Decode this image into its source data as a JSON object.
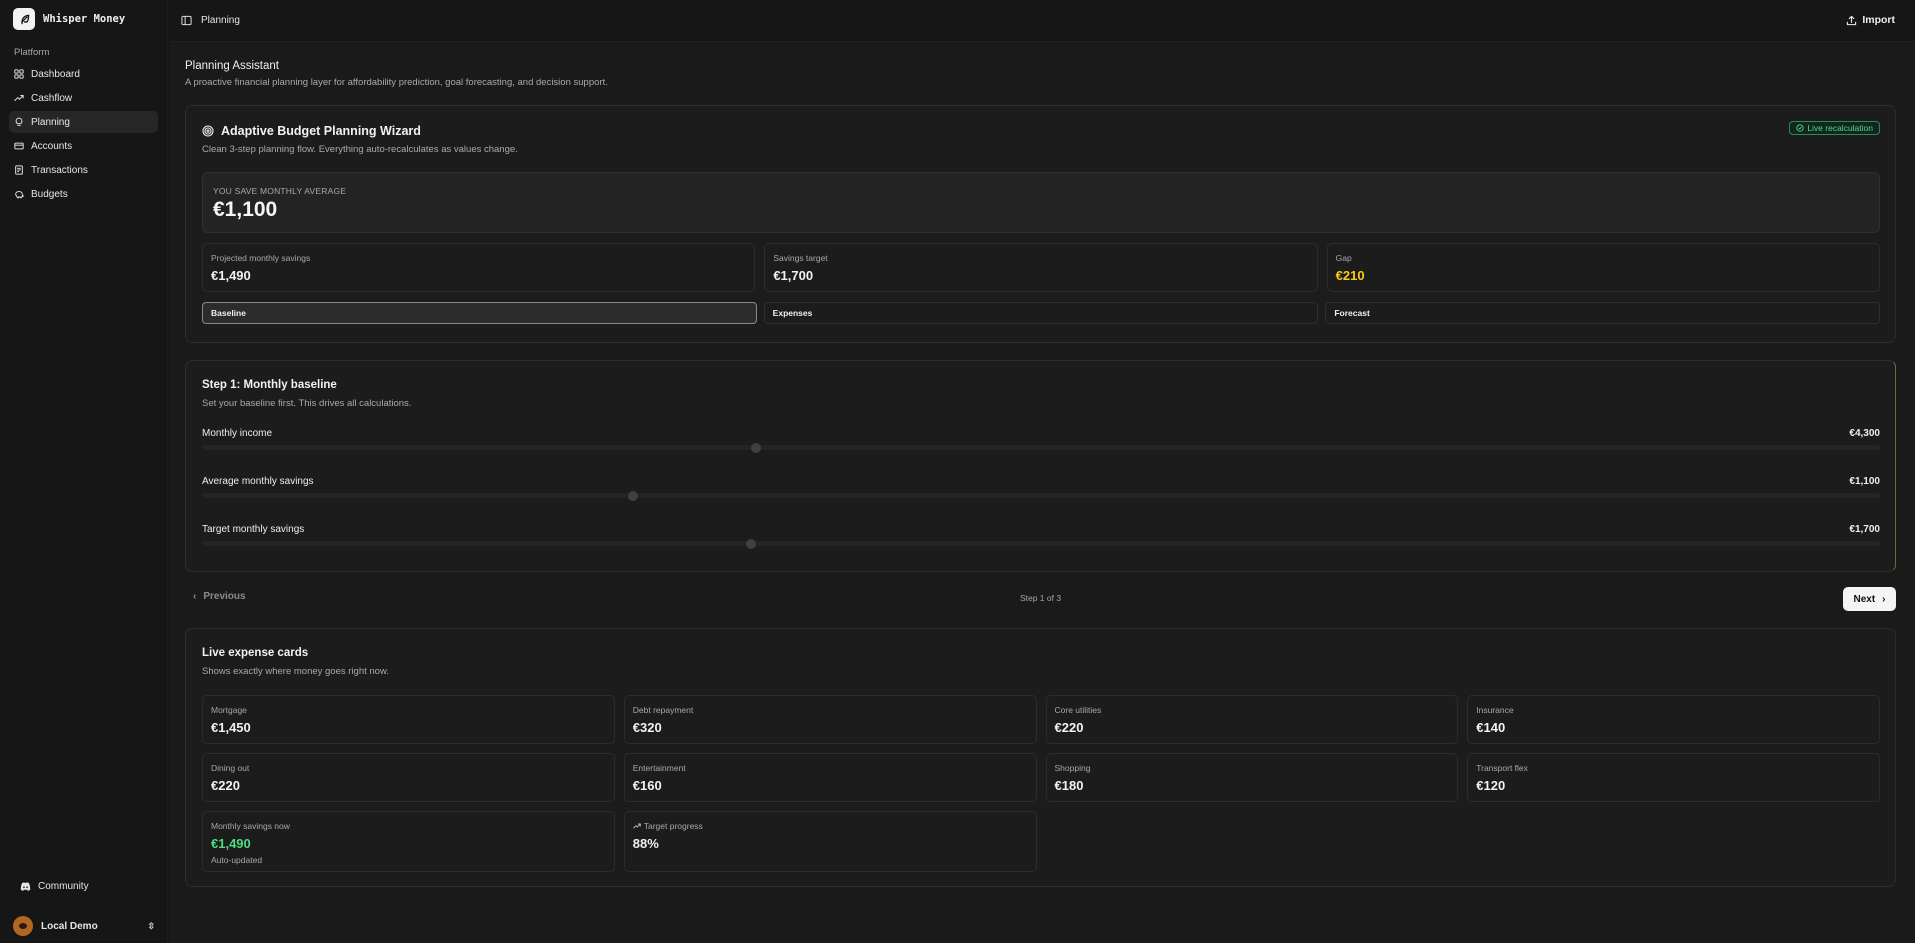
{
  "app": {
    "name": "Whisper Money"
  },
  "sidebar": {
    "group_label": "Platform",
    "items": [
      {
        "label": "Dashboard",
        "icon": "grid-icon",
        "active": false
      },
      {
        "label": "Cashflow",
        "icon": "trend-up-icon",
        "active": false
      },
      {
        "label": "Planning",
        "icon": "lightbulb-icon",
        "active": true
      },
      {
        "label": "Accounts",
        "icon": "card-icon",
        "active": false
      },
      {
        "label": "Transactions",
        "icon": "receipt-icon",
        "active": false
      },
      {
        "label": "Budgets",
        "icon": "piggy-bank-icon",
        "active": false
      }
    ],
    "community_label": "Community",
    "user_name": "Local Demo"
  },
  "topbar": {
    "title": "Planning",
    "import_label": "Import"
  },
  "page": {
    "title": "Planning Assistant",
    "subtitle": "A proactive financial planning layer for affordability prediction, goal forecasting, and decision support."
  },
  "wizard": {
    "title": "Adaptive Budget Planning Wizard",
    "subtitle": "Clean 3-step planning flow. Everything auto-recalculates as values change.",
    "badge": "Live recalculation",
    "hero_label": "YOU SAVE MONTHLY AVERAGE",
    "hero_value": "€1,100",
    "stats": [
      {
        "label": "Projected monthly savings",
        "value": "€1,490"
      },
      {
        "label": "Savings target",
        "value": "€1,700"
      },
      {
        "label": "Gap",
        "value": "€210",
        "color": "#facc15"
      }
    ],
    "tabs": [
      "Baseline",
      "Expenses",
      "Forecast"
    ],
    "active_tab": "Baseline"
  },
  "baseline": {
    "title": "Step 1: Monthly baseline",
    "subtitle": "Set your baseline first. This drives all calculations.",
    "sliders": [
      {
        "label": "Monthly income",
        "value": "€4,300",
        "level": 0.33
      },
      {
        "label": "Average monthly savings",
        "value": "€1,100",
        "level": 0.257
      },
      {
        "label": "Target monthly savings",
        "value": "€1,700",
        "level": 0.327
      }
    ]
  },
  "wizard_nav": {
    "previous_label": "Previous",
    "step_text": "Step 1 of 3",
    "next_label": "Next"
  },
  "expenses": {
    "title": "Live expense cards",
    "subtitle": "Shows exactly where money goes right now.",
    "cards": [
      {
        "label": "Mortgage",
        "value": "€1,450"
      },
      {
        "label": "Debt repayment",
        "value": "€320"
      },
      {
        "label": "Core utilities",
        "value": "€220"
      },
      {
        "label": "Insurance",
        "value": "€140"
      },
      {
        "label": "Dining out",
        "value": "€220"
      },
      {
        "label": "Entertainment",
        "value": "€160"
      },
      {
        "label": "Shopping",
        "value": "€180"
      },
      {
        "label": "Transport flex",
        "value": "€120"
      }
    ],
    "savings_now": {
      "label": "Monthly savings now",
      "value": "€1,490",
      "note": "Auto-updated",
      "color": "#4ade80"
    },
    "target_progress": {
      "label": "Target progress",
      "value": "88%",
      "icon": "trend-up-icon"
    }
  }
}
